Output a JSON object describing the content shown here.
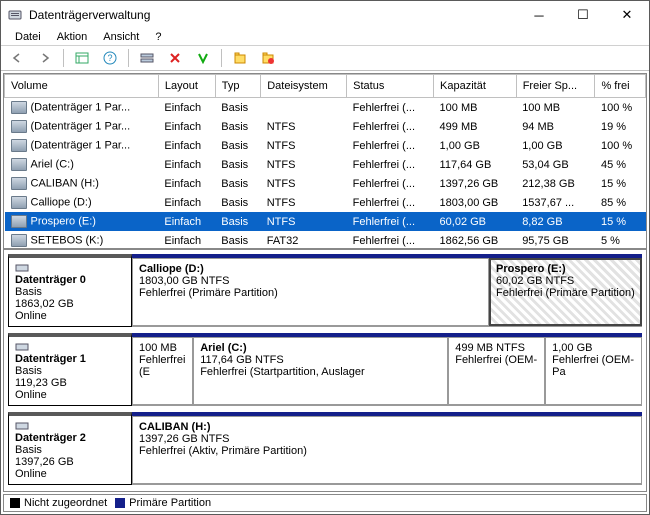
{
  "window": {
    "title": "Datenträgerverwaltung"
  },
  "menu": {
    "file": "Datei",
    "action": "Aktion",
    "view": "Ansicht",
    "help": "?"
  },
  "columns": {
    "volume": "Volume",
    "layout": "Layout",
    "type": "Typ",
    "fs": "Dateisystem",
    "status": "Status",
    "cap": "Kapazität",
    "free": "Freier Sp...",
    "pct": "% frei"
  },
  "volumes": [
    {
      "name": "(Datenträger 1 Par...",
      "layout": "Einfach",
      "type": "Basis",
      "fs": "",
      "status": "Fehlerfrei (...",
      "cap": "100 MB",
      "free": "100 MB",
      "pct": "100 %"
    },
    {
      "name": "(Datenträger 1 Par...",
      "layout": "Einfach",
      "type": "Basis",
      "fs": "NTFS",
      "status": "Fehlerfrei (...",
      "cap": "499 MB",
      "free": "94 MB",
      "pct": "19 %"
    },
    {
      "name": "(Datenträger 1 Par...",
      "layout": "Einfach",
      "type": "Basis",
      "fs": "NTFS",
      "status": "Fehlerfrei (...",
      "cap": "1,00 GB",
      "free": "1,00 GB",
      "pct": "100 %"
    },
    {
      "name": "Ariel (C:)",
      "layout": "Einfach",
      "type": "Basis",
      "fs": "NTFS",
      "status": "Fehlerfrei (...",
      "cap": "117,64 GB",
      "free": "53,04 GB",
      "pct": "45 %"
    },
    {
      "name": "CALIBAN (H:)",
      "layout": "Einfach",
      "type": "Basis",
      "fs": "NTFS",
      "status": "Fehlerfrei (...",
      "cap": "1397,26 GB",
      "free": "212,38 GB",
      "pct": "15 %"
    },
    {
      "name": "Calliope (D:)",
      "layout": "Einfach",
      "type": "Basis",
      "fs": "NTFS",
      "status": "Fehlerfrei (...",
      "cap": "1803,00 GB",
      "free": "1537,67 ...",
      "pct": "85 %"
    },
    {
      "name": "Prospero (E:)",
      "layout": "Einfach",
      "type": "Basis",
      "fs": "NTFS",
      "status": "Fehlerfrei (...",
      "cap": "60,02 GB",
      "free": "8,82 GB",
      "pct": "15 %",
      "selected": true
    },
    {
      "name": "SETEBOS (K:)",
      "layout": "Einfach",
      "type": "Basis",
      "fs": "FAT32",
      "status": "Fehlerfrei (...",
      "cap": "1862,56 GB",
      "free": "95,75 GB",
      "pct": "5 %"
    }
  ],
  "disks": [
    {
      "title": "Datenträger 0",
      "type": "Basis",
      "size": "1863,02 GB",
      "state": "Online",
      "parts": [
        {
          "label": "Calliope (D:)",
          "sub": "1803,00 GB NTFS",
          "status": "Fehlerfrei (Primäre Partition)",
          "flex": "1 1 70%"
        },
        {
          "label": "Prospero  (E:)",
          "sub": "60,02 GB NTFS",
          "status": "Fehlerfrei (Primäre Partition)",
          "flex": "0 0 30%",
          "selected": true
        }
      ]
    },
    {
      "title": "Datenträger 1",
      "type": "Basis",
      "size": "119,23 GB",
      "state": "Online",
      "parts": [
        {
          "label": "",
          "sub": "100 MB",
          "status": "Fehlerfrei (E",
          "flex": "0 0 12%"
        },
        {
          "label": "Ariel  (C:)",
          "sub": "117,64 GB NTFS",
          "status": "Fehlerfrei (Startpartition, Auslager",
          "flex": "1 1 50%"
        },
        {
          "label": "",
          "sub": "499 MB NTFS",
          "status": "Fehlerfrei (OEM-",
          "flex": "0 0 19%"
        },
        {
          "label": "",
          "sub": "1,00 GB",
          "status": "Fehlerfrei (OEM-Pa",
          "flex": "0 0 19%"
        }
      ]
    },
    {
      "title": "Datenträger 2",
      "type": "Basis",
      "size": "1397,26 GB",
      "state": "Online",
      "parts": [
        {
          "label": "CALIBAN  (H:)",
          "sub": "1397,26 GB NTFS",
          "status": "Fehlerfrei (Aktiv, Primäre Partition)",
          "flex": "1 1 100%"
        }
      ]
    }
  ],
  "legend": {
    "unalloc": "Nicht zugeordnet",
    "primary": "Primäre Partition"
  }
}
